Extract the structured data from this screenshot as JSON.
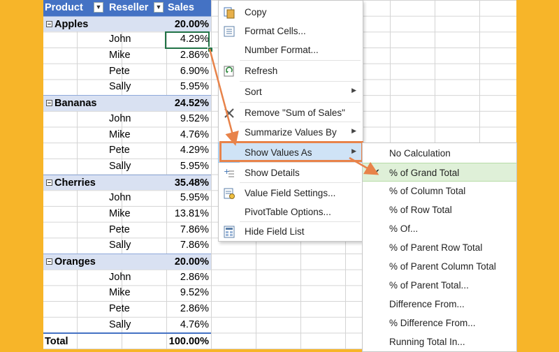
{
  "pivot": {
    "headers": {
      "product": "Product",
      "reseller": "Reseller",
      "sales": "Sales"
    },
    "groups": [
      {
        "name": "Apples",
        "total": "20.00%",
        "rows": [
          {
            "reseller": "John",
            "value": "4.29%"
          },
          {
            "reseller": "Mike",
            "value": "2.86%"
          },
          {
            "reseller": "Pete",
            "value": "6.90%"
          },
          {
            "reseller": "Sally",
            "value": "5.95%"
          }
        ]
      },
      {
        "name": "Bananas",
        "total": "24.52%",
        "rows": [
          {
            "reseller": "John",
            "value": "9.52%"
          },
          {
            "reseller": "Mike",
            "value": "4.76%"
          },
          {
            "reseller": "Pete",
            "value": "4.29%"
          },
          {
            "reseller": "Sally",
            "value": "5.95%"
          }
        ]
      },
      {
        "name": "Cherries",
        "total": "35.48%",
        "rows": [
          {
            "reseller": "John",
            "value": "5.95%"
          },
          {
            "reseller": "Mike",
            "value": "13.81%"
          },
          {
            "reseller": "Pete",
            "value": "7.86%"
          },
          {
            "reseller": "Sally",
            "value": "7.86%"
          }
        ]
      },
      {
        "name": "Oranges",
        "total": "20.00%",
        "rows": [
          {
            "reseller": "John",
            "value": "2.86%"
          },
          {
            "reseller": "Mike",
            "value": "9.52%"
          },
          {
            "reseller": "Pete",
            "value": "2.86%"
          },
          {
            "reseller": "Sally",
            "value": "4.76%"
          }
        ]
      }
    ],
    "total_label": "Total",
    "total_value": "100.00%"
  },
  "context_menu": {
    "items": [
      {
        "label": "Copy",
        "icon": "copy-icon"
      },
      {
        "label": "Format Cells...",
        "icon": "format-cells-icon"
      },
      {
        "label": "Number Format...",
        "icon": ""
      },
      {
        "label": "Refresh",
        "icon": "refresh-icon"
      },
      {
        "label": "Sort",
        "icon": "",
        "submenu": true
      },
      {
        "label": "Remove \"Sum of  Sales\"",
        "icon": "remove-x-icon"
      },
      {
        "label": "Summarize Values By",
        "icon": "",
        "submenu": true
      },
      {
        "label": "Show Values As",
        "icon": "",
        "submenu": true,
        "highlighted": true
      },
      {
        "label": "Show Details",
        "icon": "show-details-icon"
      },
      {
        "label": "Value Field Settings...",
        "icon": "field-settings-icon"
      },
      {
        "label": "PivotTable Options...",
        "icon": ""
      },
      {
        "label": "Hide Field List",
        "icon": "field-list-icon"
      }
    ]
  },
  "show_values_submenu": {
    "items": [
      {
        "label": "No Calculation"
      },
      {
        "label": "% of Grand Total",
        "checked": true
      },
      {
        "label": "% of Column Total"
      },
      {
        "label": "% of Row Total"
      },
      {
        "label": "% Of..."
      },
      {
        "label": "% of Parent Row Total"
      },
      {
        "label": "% of Parent Column Total"
      },
      {
        "label": "% of Parent Total..."
      },
      {
        "label": "Difference From..."
      },
      {
        "label": "% Difference From..."
      },
      {
        "label": "Running Total In..."
      }
    ]
  },
  "colors": {
    "background": "#F7B529",
    "header": "#4472C4",
    "group_row": "#D9E1F2",
    "menu_highlight": "#CFE3F6",
    "submenu_highlight": "#DFF0D8",
    "callout_arrow": "#E8834A",
    "selection": "#217346"
  }
}
